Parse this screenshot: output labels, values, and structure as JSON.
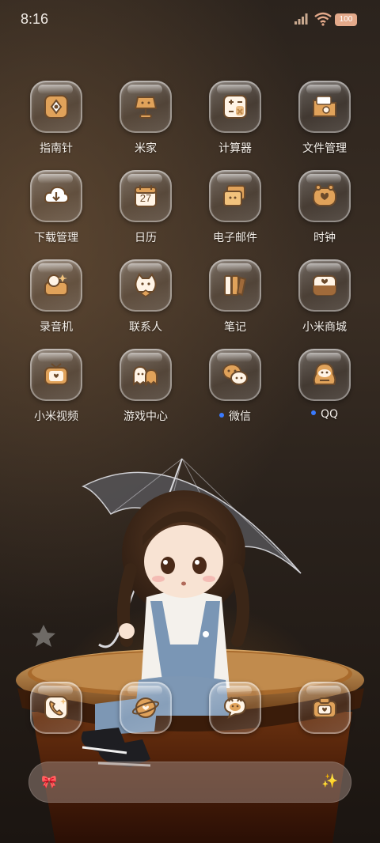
{
  "status_bar": {
    "time": "8:16",
    "battery": "100",
    "signal_icon": "signal-icon",
    "wifi_icon": "wifi-icon"
  },
  "apps": [
    {
      "label": "指南针",
      "icon": "compass-icon",
      "notify": false
    },
    {
      "label": "米家",
      "icon": "lamp-icon",
      "notify": false
    },
    {
      "label": "计算器",
      "icon": "calculator-icon",
      "notify": false
    },
    {
      "label": "文件管理",
      "icon": "folder-icon",
      "notify": false
    },
    {
      "label": "下载管理",
      "icon": "download-cloud-icon",
      "notify": false
    },
    {
      "label": "日历",
      "icon": "calendar-icon",
      "notify": false,
      "calendar_day": "27"
    },
    {
      "label": "电子邮件",
      "icon": "mail-icon",
      "notify": false
    },
    {
      "label": "时钟",
      "icon": "clock-icon",
      "notify": false
    },
    {
      "label": "录音机",
      "icon": "recorder-icon",
      "notify": false
    },
    {
      "label": "联系人",
      "icon": "contacts-icon",
      "notify": false
    },
    {
      "label": "笔记",
      "icon": "notes-icon",
      "notify": false
    },
    {
      "label": "小米商城",
      "icon": "store-icon",
      "notify": false
    },
    {
      "label": "小米视频",
      "icon": "tv-icon",
      "notify": false
    },
    {
      "label": "游戏中心",
      "icon": "ghost-icon",
      "notify": false
    },
    {
      "label": "微信",
      "icon": "wechat-icon",
      "notify": true
    },
    {
      "label": "QQ",
      "icon": "qq-penguin-icon",
      "notify": true
    }
  ],
  "dock": [
    {
      "icon": "phone-icon"
    },
    {
      "icon": "browser-icon"
    },
    {
      "icon": "messages-icon"
    },
    {
      "icon": "camera-icon"
    }
  ],
  "search_bar": {
    "left_icon": "bow-icon",
    "left_glyph": "🎀",
    "right_icon": "sparkle-icon",
    "right_glyph": "✨"
  },
  "colors": {
    "icon_orange": "#e0a25a",
    "icon_dark": "#6b4a2b",
    "notify_dot": "#3a7bff",
    "battery": "#e3a98a"
  }
}
